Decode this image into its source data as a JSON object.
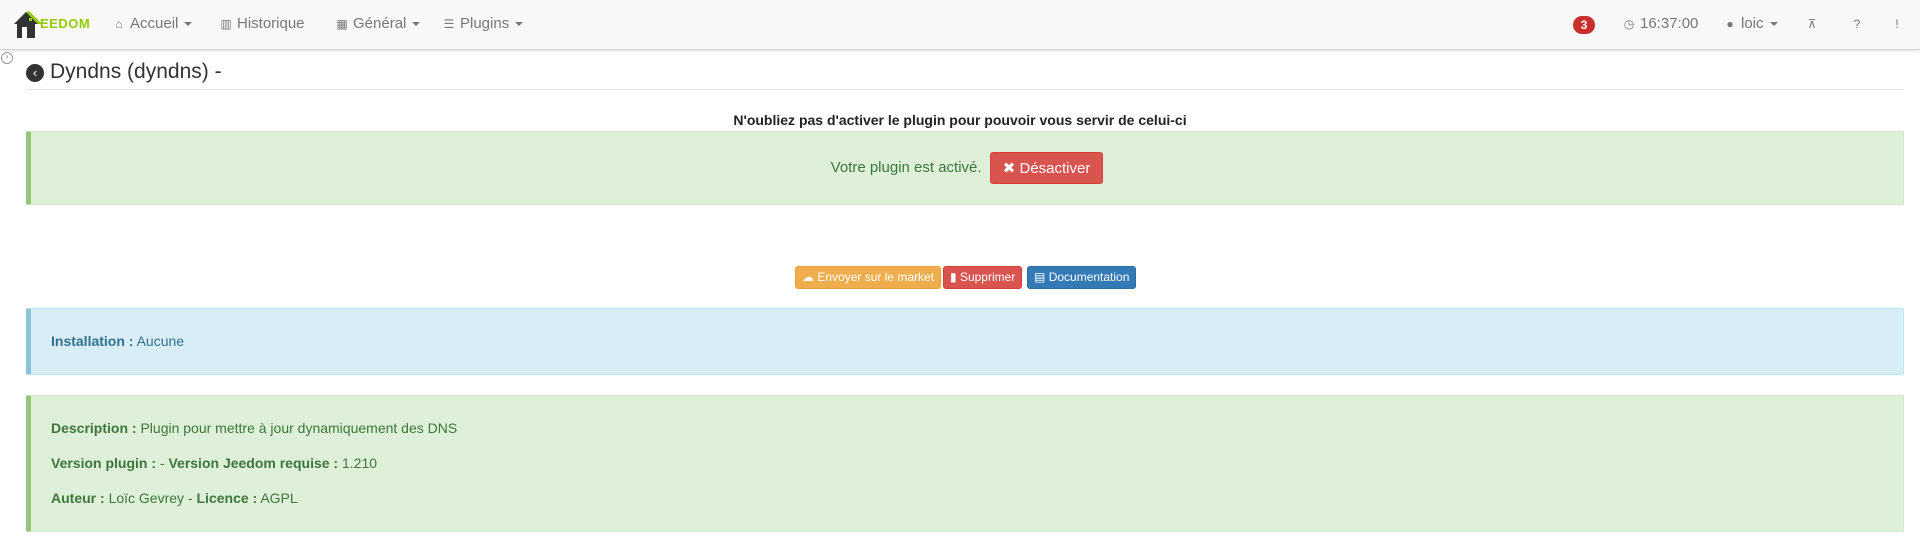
{
  "navbar": {
    "logo_text": "EEDOM",
    "items": [
      {
        "icon": "home-icon",
        "glyph": "⌂",
        "label": "Accueil",
        "dropdown": true
      },
      {
        "icon": "bar-chart-icon",
        "glyph": "▥",
        "label": "Historique",
        "dropdown": false
      },
      {
        "icon": "grid-icon",
        "glyph": "▦",
        "label": "Général",
        "dropdown": true
      },
      {
        "icon": "tasks-icon",
        "glyph": "☰",
        "label": "Plugins",
        "dropdown": true
      }
    ],
    "notification_count": "3",
    "time": "16:37:00",
    "user": "loic"
  },
  "page": {
    "title": "Dyndns (dyndns) -",
    "notice": "N'oubliez pas d'activer le plugin pour pouvoir vous servir de celui-ci",
    "activated_text": "Votre plugin est activé.",
    "deactivate_label": "Désactiver"
  },
  "actions": {
    "market_label": "Envoyer sur le market",
    "delete_label": "Supprimer",
    "doc_label": "Documentation"
  },
  "installation": {
    "label": "Installation :",
    "value": "Aucune"
  },
  "info": {
    "description_label": "Description :",
    "description_value": "Plugin pour mettre à jour dynamiquement des DNS",
    "version_label": "Version plugin :",
    "version_sep": "-",
    "jeedom_label": "Version Jeedom requise :",
    "jeedom_value": "1.210",
    "author_label": "Auteur :",
    "author_value": "Loïc Gevrey",
    "license_label": "Licence :",
    "license_value": "AGPL"
  },
  "colors": {
    "success_bg": "#dff0d8",
    "info_bg": "#d9edf7",
    "danger": "#d9534f",
    "warning": "#f0ad4e",
    "primary": "#337ab7",
    "brand": "#94ca02"
  }
}
